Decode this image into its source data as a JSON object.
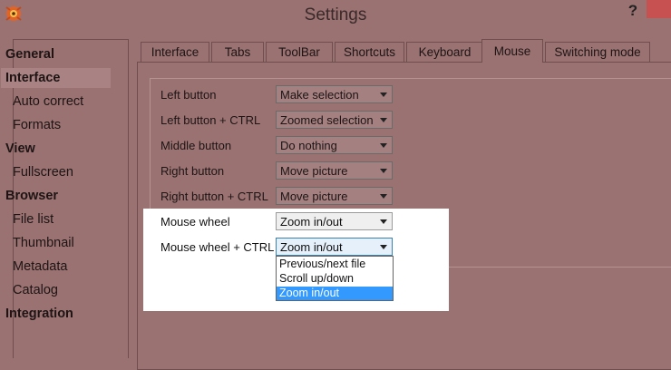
{
  "window": {
    "title": "Settings",
    "help_label": "?",
    "accent": "#3399ff",
    "bg": "#9a7272"
  },
  "nav": {
    "items": [
      {
        "label": "General",
        "level": "top"
      },
      {
        "label": "Interface",
        "level": "top",
        "selected": true
      },
      {
        "label": "Auto correct",
        "level": "sub"
      },
      {
        "label": "Formats",
        "level": "sub"
      },
      {
        "label": "View",
        "level": "top"
      },
      {
        "label": "Fullscreen",
        "level": "sub"
      },
      {
        "label": "Browser",
        "level": "top"
      },
      {
        "label": "File list",
        "level": "sub"
      },
      {
        "label": "Thumbnail",
        "level": "sub"
      },
      {
        "label": "Metadata",
        "level": "sub"
      },
      {
        "label": "Catalog",
        "level": "sub"
      },
      {
        "label": "Integration",
        "level": "top"
      }
    ]
  },
  "tabs": [
    {
      "label": "Interface"
    },
    {
      "label": "Tabs"
    },
    {
      "label": "ToolBar"
    },
    {
      "label": "Shortcuts"
    },
    {
      "label": "Keyboard"
    },
    {
      "label": "Mouse",
      "active": true
    },
    {
      "label": "Switching mode"
    }
  ],
  "mouse": {
    "rows": [
      {
        "label": "Left button",
        "value": "Make selection"
      },
      {
        "label": "Left button + CTRL",
        "value": "Zoomed selection"
      },
      {
        "label": "Middle button",
        "value": "Do nothing"
      },
      {
        "label": "Right button",
        "value": "Move picture"
      },
      {
        "label": "Right button + CTRL",
        "value": "Move picture"
      },
      {
        "label": "Mouse wheel",
        "value": "Zoom in/out"
      },
      {
        "label": "Mouse wheel + CTRL",
        "value": "Zoom in/out"
      }
    ],
    "dropdown_options": [
      {
        "label": "Previous/next file"
      },
      {
        "label": "Scroll up/down"
      },
      {
        "label": "Zoom in/out",
        "selected": true
      }
    ]
  }
}
